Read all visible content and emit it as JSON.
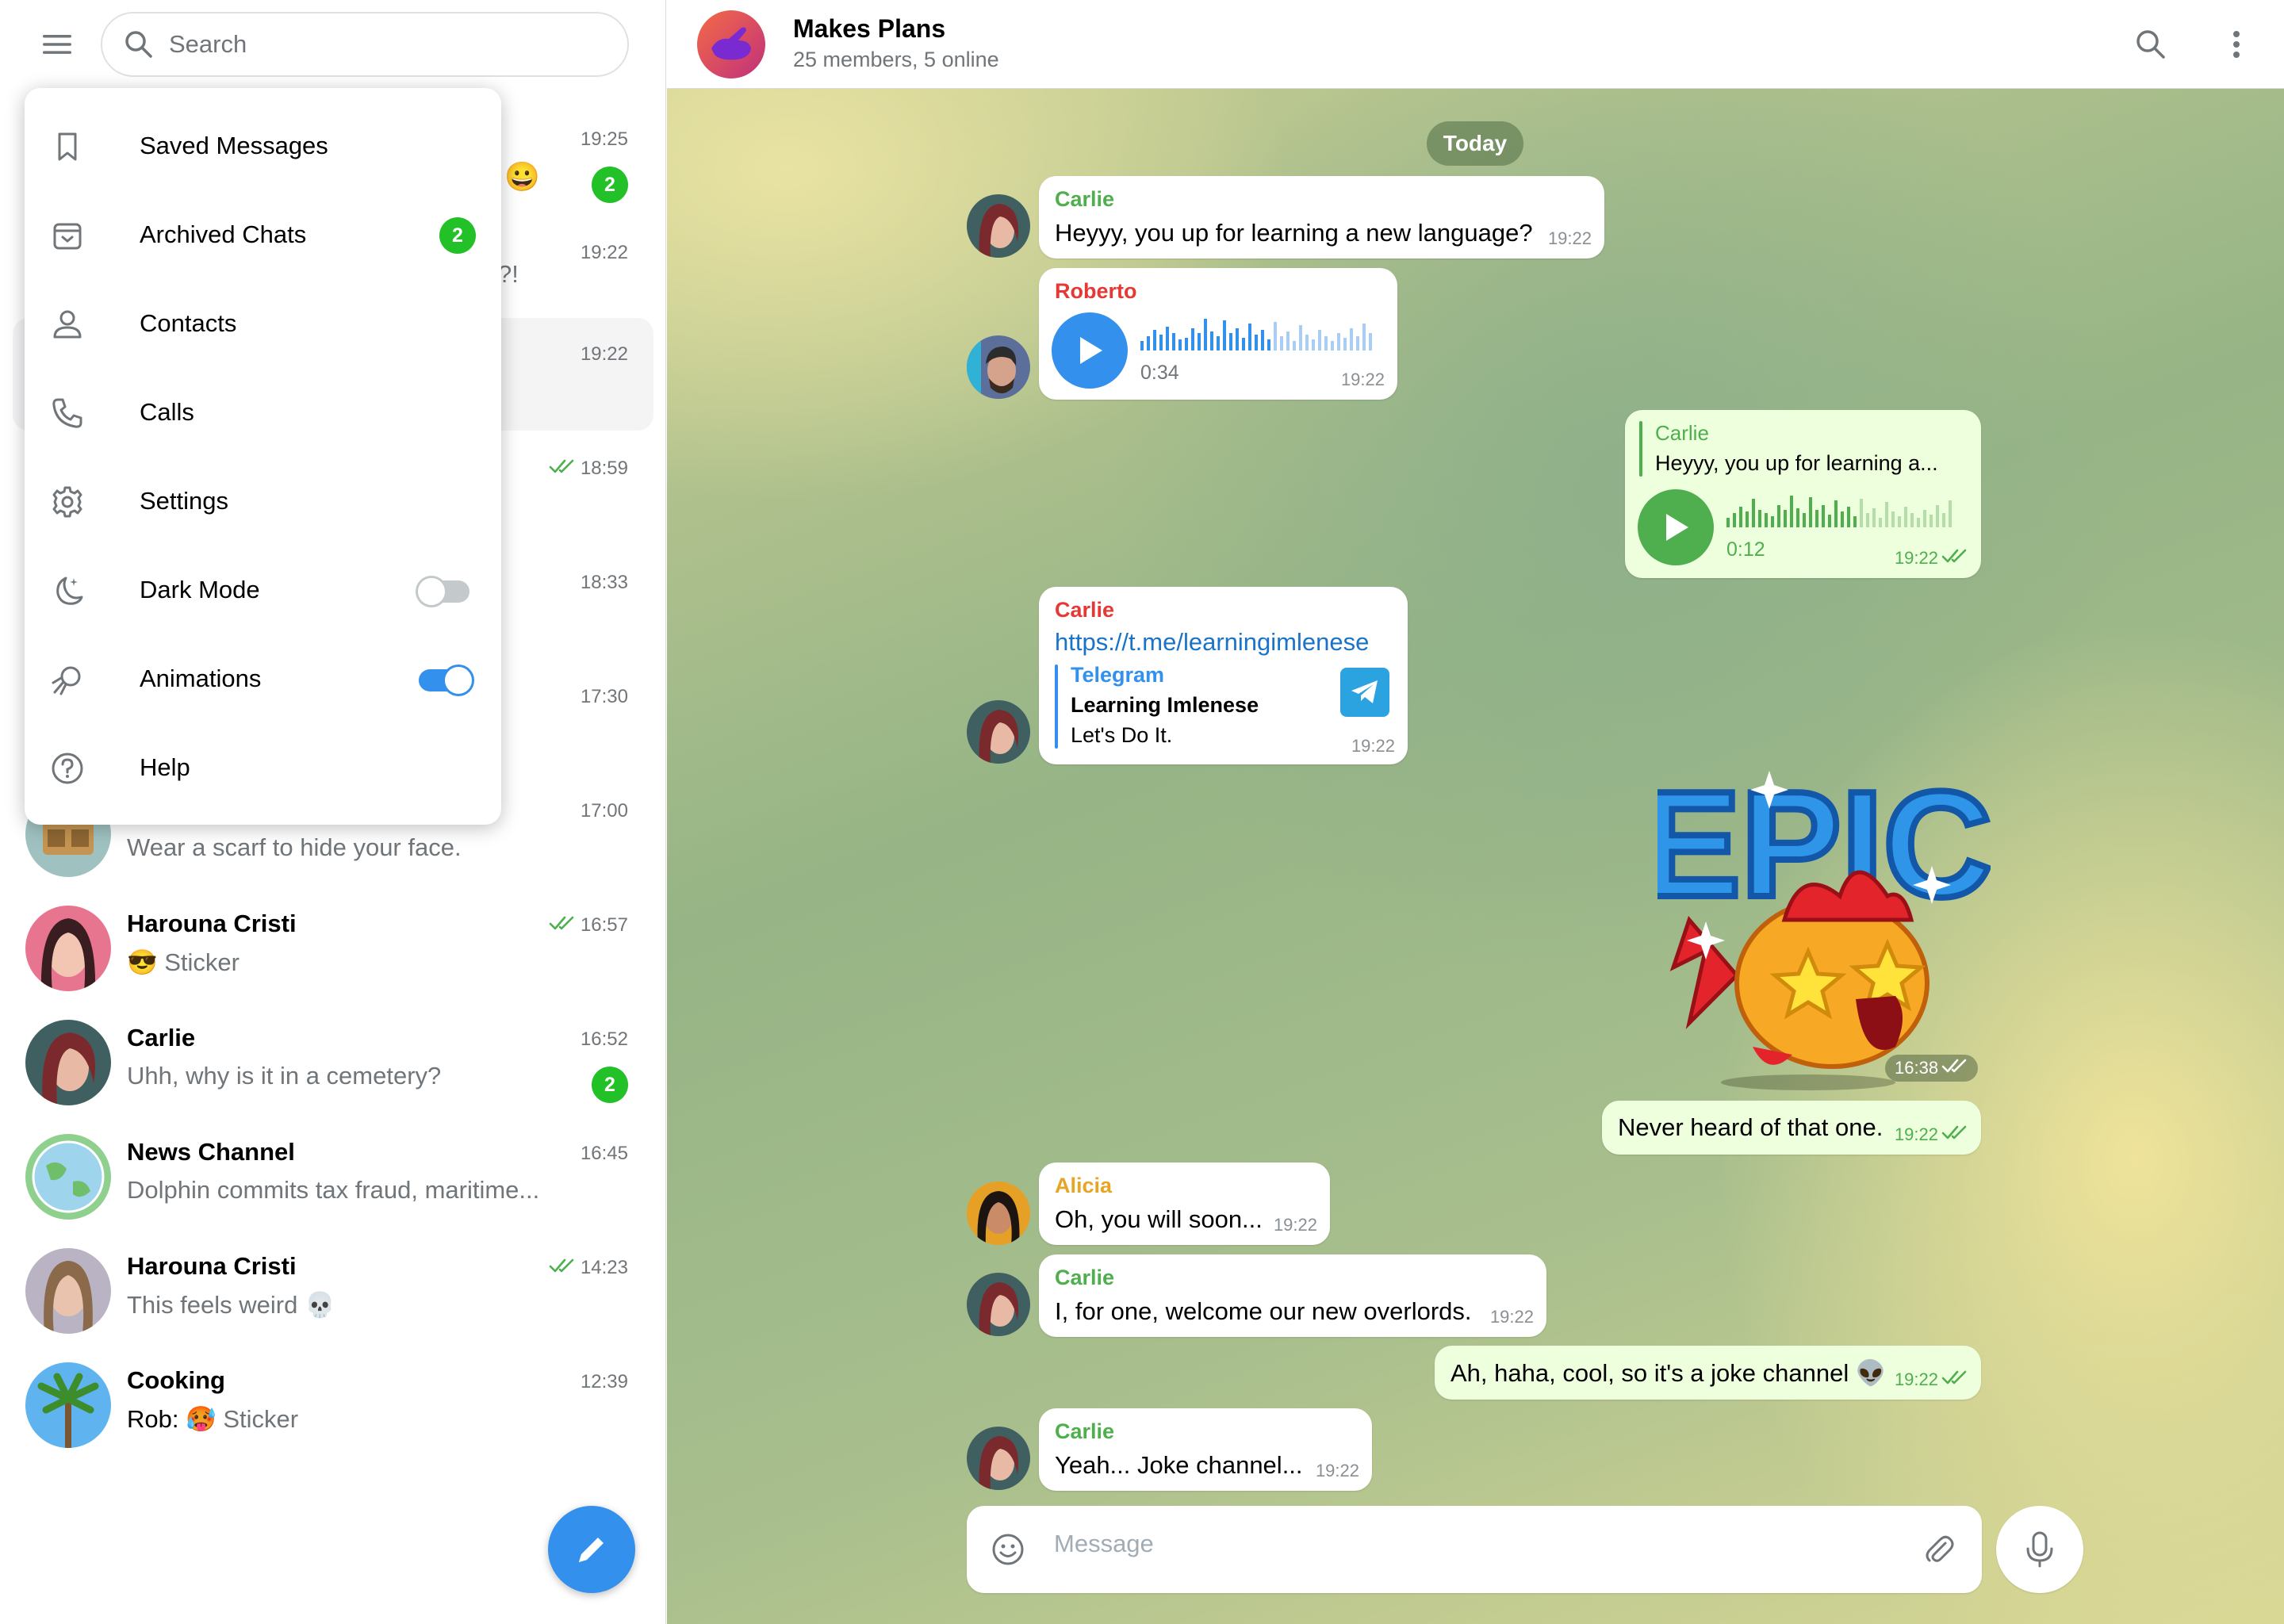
{
  "search": {
    "placeholder": "Search"
  },
  "menu": {
    "items": [
      {
        "label": "Saved Messages"
      },
      {
        "label": "Archived Chats",
        "badge": "2"
      },
      {
        "label": "Contacts"
      },
      {
        "label": "Calls"
      },
      {
        "label": "Settings"
      },
      {
        "label": "Dark Mode",
        "toggle": "off"
      },
      {
        "label": "Animations",
        "toggle": "on"
      },
      {
        "label": "Help"
      }
    ]
  },
  "chats": [
    {
      "time": "19:25",
      "badge": "2",
      "preview_fragment": "😀"
    },
    {
      "time": "19:22",
      "preview_fragment": "?!"
    },
    {
      "time": "19:22"
    },
    {
      "time": "18:59",
      "read": true
    },
    {
      "time": "18:33"
    },
    {
      "time": "17:30"
    },
    {
      "time": "17:00",
      "preview": "Wear a scarf to hide your face."
    },
    {
      "name": "Harouna Cristi",
      "preview": "😎 Sticker",
      "time": "16:57",
      "read": true
    },
    {
      "name": "Carlie",
      "preview": "Uhh, why is it in a cemetery?",
      "time": "16:52",
      "badge": "2"
    },
    {
      "name": "News Channel",
      "preview": "Dolphin commits tax fraud, maritime...",
      "time": "16:45"
    },
    {
      "name": "Harouna Cristi",
      "preview": "This feels weird 💀",
      "time": "14:23",
      "read": true
    },
    {
      "name": "Cooking",
      "preview_sender": "Rob:",
      "preview": "🥵 Sticker",
      "time": "12:39"
    }
  ],
  "header": {
    "title": "Makes Plans",
    "subtitle": "25 members, 5 online"
  },
  "day_divider": "Today",
  "messages": [
    {
      "sender": "Carlie",
      "text": "Heyyy, you up for learning a new language?",
      "time": "19:22"
    },
    {
      "sender": "Roberto",
      "type": "voice",
      "duration": "0:34",
      "time": "19:22"
    },
    {
      "sender": "Carlie",
      "type": "voice",
      "reply_text": "Heyyy, you up for learning a...",
      "duration": "0:12",
      "time": "19:22",
      "outgoing": true
    },
    {
      "sender": "Carlie",
      "link": "https://t.me/learningimlenese",
      "preview_site": "Telegram",
      "preview_title": "Learning Imlenese",
      "preview_desc": "Let's Do It.",
      "time": "19:22"
    },
    {
      "type": "sticker",
      "sticker_text": "EPIC",
      "time": "16:38",
      "outgoing": true
    },
    {
      "text": "Never heard of that one.",
      "time": "19:22",
      "outgoing": true
    },
    {
      "sender": "Alicia",
      "text": "Oh, you will soon...",
      "time": "19:22"
    },
    {
      "sender": "Carlie",
      "text": "I, for one, welcome our new overlords.",
      "time": "19:22"
    },
    {
      "text": "Ah, haha, cool, so it's a joke channel 👽",
      "time": "19:22",
      "outgoing": true
    },
    {
      "sender": "Carlie",
      "text": "Yeah... Joke channel...",
      "time": "19:22"
    }
  ],
  "composer": {
    "placeholder": "Message"
  },
  "colors": {
    "accent": "#3390ec",
    "badge": "#22c127",
    "outgoing_bubble": "#eeffde",
    "carlie": "#4fae4e",
    "roberto": "#e53935",
    "alicia": "#e8a425",
    "link": "#1a73c8"
  }
}
